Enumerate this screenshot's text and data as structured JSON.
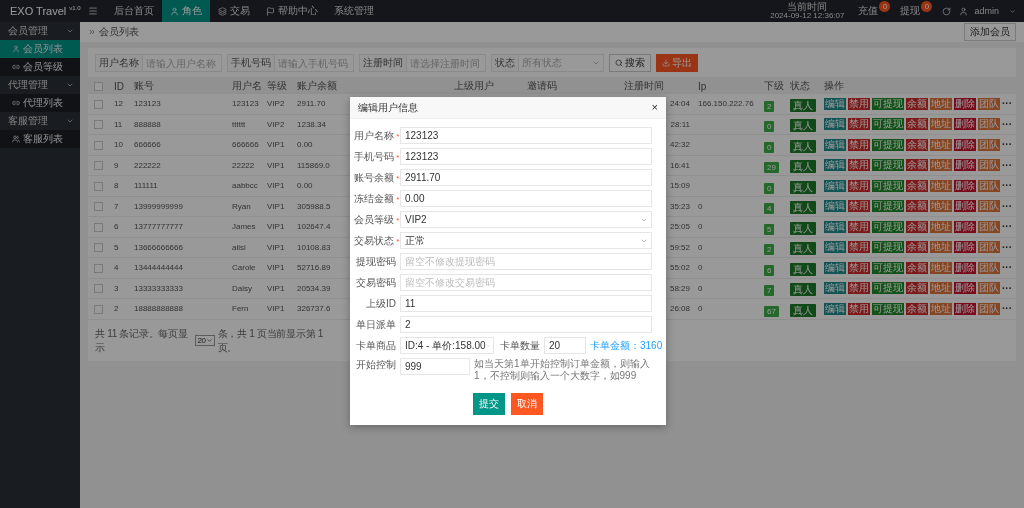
{
  "topbar": {
    "logo": "EXO Travel $^{v1.0}$",
    "nav": [
      {
        "label": "后台首页",
        "selected": false,
        "kind": "plain"
      },
      {
        "label": "角色",
        "selected": true,
        "kind": "user"
      },
      {
        "label": "交易",
        "selected": false,
        "kind": "layers"
      },
      {
        "label": "帮助中心",
        "selected": false,
        "kind": "flag"
      },
      {
        "label": "系统管理",
        "selected": false,
        "kind": "plain"
      }
    ],
    "time_label": "当前时间",
    "time": "2024-09-12 12:36:07",
    "links": [
      {
        "label": "充值",
        "badge": "0"
      },
      {
        "label": "提现",
        "badge": "0"
      }
    ],
    "user": "admin"
  },
  "sidebar": {
    "groups": [
      {
        "label": "会员管理",
        "expanded": true,
        "items": [
          {
            "label": "会员列表",
            "selected": true,
            "kind": "user"
          },
          {
            "label": "会员等级",
            "selected": false,
            "kind": "link"
          }
        ]
      },
      {
        "label": "代理管理",
        "expanded": true,
        "items": [
          {
            "label": "代理列表",
            "selected": false,
            "kind": "link"
          }
        ]
      },
      {
        "label": "客服管理",
        "expanded": true,
        "items": [
          {
            "label": "客服列表",
            "selected": false,
            "kind": "team"
          }
        ]
      }
    ]
  },
  "breadcrumb": "会员列表",
  "add_button": "添加会员",
  "filters": [
    {
      "label": "用户名称",
      "placeholder": "请输入用户名称",
      "kind": "input"
    },
    {
      "label": "手机号码",
      "placeholder": "请输入手机号码",
      "kind": "input"
    },
    {
      "label": "注册时间",
      "placeholder": "请选择注册时间",
      "kind": "input"
    },
    {
      "label": "状态",
      "placeholder": "所有状态",
      "kind": "select"
    }
  ],
  "search_button": "搜索",
  "export_button": "导出",
  "table": {
    "header_checked": false,
    "columns": [
      "ID",
      "账号",
      "用户名",
      "等级",
      "账户余额",
      "上级用户",
      "邀请码",
      "注册时间",
      "Ip",
      "下级",
      "状态",
      "操作"
    ],
    "rows": [
      {
        "checked": false,
        "id": "12",
        "account": "123123",
        "username": "123123",
        "level": "VIP2",
        "balance": "2911.70",
        "time": "24:04",
        "ip": "166.150.222.76",
        "subs": "2",
        "status": "真人",
        "actions": [
          {
            "label": "编辑",
            "color": "#125454"
          },
          {
            "label": "禁用",
            "color": "#7e1a1a"
          },
          {
            "label": "可提现",
            "color": "#145219"
          },
          {
            "label": "余额",
            "color": "#7e1a1a"
          },
          {
            "label": "地址",
            "color": "#864624"
          },
          {
            "label": "删除",
            "color": "#780a1c"
          },
          {
            "label": "团队",
            "color": "#864624"
          }
        ],
        "more": "···"
      },
      {
        "checked": false,
        "id": "11",
        "account": "888888",
        "username": "tttttt",
        "level": "VIP2",
        "balance": "1238.34",
        "time": "28:11",
        "subs": "0",
        "status": "真人",
        "actions": [
          {
            "label": "编辑",
            "color": "#125454"
          },
          {
            "label": "禁用",
            "color": "#7e1a1a"
          },
          {
            "label": "可提现",
            "color": "#145219"
          },
          {
            "label": "余额",
            "color": "#7e1a1a"
          },
          {
            "label": "地址",
            "color": "#864624"
          },
          {
            "label": "删除",
            "color": "#780a1c"
          },
          {
            "label": "团队",
            "color": "#864624"
          }
        ],
        "more": "···"
      },
      {
        "checked": false,
        "id": "10",
        "account": "666666",
        "username": "666666",
        "level": "VIP1",
        "balance": "0.00",
        "time": "42:32",
        "subs": "0",
        "status": "真人",
        "actions": [
          {
            "label": "编辑",
            "color": "#125454"
          },
          {
            "label": "禁用",
            "color": "#7e1a1a"
          },
          {
            "label": "可提现",
            "color": "#145219"
          },
          {
            "label": "余额",
            "color": "#7e1a1a"
          },
          {
            "label": "地址",
            "color": "#864624"
          },
          {
            "label": "删除",
            "color": "#780a1c"
          },
          {
            "label": "团队",
            "color": "#864624"
          }
        ],
        "more": "···"
      },
      {
        "checked": false,
        "id": "9",
        "account": "222222",
        "username": "22222",
        "level": "VIP1",
        "balance": "115869.0",
        "time": "16:41",
        "subs": "29",
        "status": "真人",
        "actions": [
          {
            "label": "编辑",
            "color": "#125454"
          },
          {
            "label": "禁用",
            "color": "#7e1a1a"
          },
          {
            "label": "可提现",
            "color": "#145219"
          },
          {
            "label": "余额",
            "color": "#7e1a1a"
          },
          {
            "label": "地址",
            "color": "#864624"
          },
          {
            "label": "删除",
            "color": "#780a1c"
          },
          {
            "label": "团队",
            "color": "#864624"
          }
        ],
        "more": "···"
      },
      {
        "checked": false,
        "id": "8",
        "account": "111111",
        "username": "aabbcc",
        "level": "VIP1",
        "balance": "0.00",
        "time": "15:09",
        "subs": "0",
        "status": "真人",
        "actions": [
          {
            "label": "编辑",
            "color": "#125454"
          },
          {
            "label": "禁用",
            "color": "#7e1a1a"
          },
          {
            "label": "可提现",
            "color": "#145219"
          },
          {
            "label": "余额",
            "color": "#7e1a1a"
          },
          {
            "label": "地址",
            "color": "#864624"
          },
          {
            "label": "删除",
            "color": "#780a1c"
          },
          {
            "label": "团队",
            "color": "#864624"
          }
        ],
        "more": "···"
      },
      {
        "checked": false,
        "id": "7",
        "account": "13999999999",
        "username": "Ryan",
        "level": "VIP1",
        "balance": "305988.5",
        "time": "35:23",
        "ip": "0",
        "subs": "4",
        "status": "真人",
        "actions": [
          {
            "label": "编辑",
            "color": "#125454"
          },
          {
            "label": "禁用",
            "color": "#7e1a1a"
          },
          {
            "label": "可提现",
            "color": "#145219"
          },
          {
            "label": "余额",
            "color": "#7e1a1a"
          },
          {
            "label": "地址",
            "color": "#864624"
          },
          {
            "label": "删除",
            "color": "#780a1c"
          },
          {
            "label": "团队",
            "color": "#864624"
          }
        ],
        "more": "···"
      },
      {
        "checked": false,
        "id": "6",
        "account": "13777777777",
        "username": "James",
        "level": "VIP1",
        "balance": "102647.4",
        "time": "25:05",
        "ip": "0",
        "subs": "5",
        "status": "真人",
        "actions": [
          {
            "label": "编辑",
            "color": "#125454"
          },
          {
            "label": "禁用",
            "color": "#7e1a1a"
          },
          {
            "label": "可提现",
            "color": "#145219"
          },
          {
            "label": "余额",
            "color": "#7e1a1a"
          },
          {
            "label": "地址",
            "color": "#864624"
          },
          {
            "label": "删除",
            "color": "#780a1c"
          },
          {
            "label": "团队",
            "color": "#864624"
          }
        ],
        "more": "···"
      },
      {
        "checked": false,
        "id": "5",
        "account": "13666666666",
        "username": "alisi",
        "level": "VIP1",
        "balance": "10108.83",
        "time": "59:52",
        "ip": "0",
        "subs": "2",
        "status": "真人",
        "actions": [
          {
            "label": "编辑",
            "color": "#125454"
          },
          {
            "label": "禁用",
            "color": "#7e1a1a"
          },
          {
            "label": "可提现",
            "color": "#145219"
          },
          {
            "label": "余额",
            "color": "#7e1a1a"
          },
          {
            "label": "地址",
            "color": "#864624"
          },
          {
            "label": "删除",
            "color": "#780a1c"
          },
          {
            "label": "团队",
            "color": "#864624"
          }
        ],
        "more": "···"
      },
      {
        "checked": false,
        "id": "4",
        "account": "13444444444",
        "username": "Carole",
        "level": "VIP1",
        "balance": "52716.89",
        "time": "55:02",
        "ip": "0",
        "subs": "6",
        "status": "真人",
        "actions": [
          {
            "label": "编辑",
            "color": "#125454"
          },
          {
            "label": "禁用",
            "color": "#7e1a1a"
          },
          {
            "label": "可提现",
            "color": "#145219"
          },
          {
            "label": "余额",
            "color": "#7e1a1a"
          },
          {
            "label": "地址",
            "color": "#864624"
          },
          {
            "label": "删除",
            "color": "#780a1c"
          },
          {
            "label": "团队",
            "color": "#864624"
          }
        ],
        "more": "···"
      },
      {
        "checked": false,
        "id": "3",
        "account": "13333333333",
        "username": "Daisy",
        "level": "VIP1",
        "balance": "20534.39",
        "time": "58:29",
        "ip": "0",
        "subs": "7",
        "status": "真人",
        "actions": [
          {
            "label": "编辑",
            "color": "#125454"
          },
          {
            "label": "禁用",
            "color": "#7e1a1a"
          },
          {
            "label": "可提现",
            "color": "#145219"
          },
          {
            "label": "余额",
            "color": "#7e1a1a"
          },
          {
            "label": "地址",
            "color": "#864624"
          },
          {
            "label": "删除",
            "color": "#780a1c"
          },
          {
            "label": "团队",
            "color": "#864624"
          }
        ],
        "more": "···"
      },
      {
        "checked": false,
        "id": "2",
        "account": "18888888888",
        "username": "Fern",
        "level": "VIP1",
        "balance": "326737.6",
        "time": "26:08",
        "ip": "0",
        "subs": "67",
        "status": "真人",
        "actions": [
          {
            "label": "编辑",
            "color": "#125454"
          },
          {
            "label": "禁用",
            "color": "#7e1a1a"
          },
          {
            "label": "可提现",
            "color": "#145219"
          },
          {
            "label": "余额",
            "color": "#7e1a1a"
          },
          {
            "label": "地址",
            "color": "#864624"
          },
          {
            "label": "删除",
            "color": "#780a1c"
          },
          {
            "label": "团队",
            "color": "#864624"
          }
        ],
        "more": "···"
      }
    ]
  },
  "pager": {
    "before": "共 11 条记录。每页显示",
    "page_size": "20",
    "after": "条，共 1 页当前显示第 1 页。"
  },
  "modal": {
    "title": "编辑用户信息",
    "close": "×",
    "fields": [
      {
        "kind": "text",
        "label": "用户名称",
        "mark": "*",
        "value": "123123"
      },
      {
        "kind": "text",
        "label": "手机号码",
        "mark": "*",
        "value": "123123"
      },
      {
        "kind": "text",
        "label": "账号余额",
        "mark": "*",
        "value": "2911.70"
      },
      {
        "kind": "text",
        "label": "冻结金额",
        "mark": "*",
        "value": "0.00"
      },
      {
        "kind": "select",
        "label": "会员等级",
        "mark": "*",
        "value": "VIP2"
      },
      {
        "kind": "select",
        "label": "交易状态",
        "mark": "*",
        "value": "正常"
      },
      {
        "kind": "text",
        "label": "提现密码",
        "placeholder": "留空不修改提现密码"
      },
      {
        "kind": "text",
        "label": "交易密码",
        "placeholder": "留空不修改交易密码"
      },
      {
        "kind": "text",
        "label": "上级ID",
        "value": "11"
      },
      {
        "kind": "text",
        "label": "单日派单",
        "value": "2"
      },
      {
        "kind": "card",
        "label": "卡单商品",
        "value": "ID:4 - 单价:158.00",
        "label_2": "卡单数量",
        "value_2": "20",
        "note": "卡单金额：3160"
      },
      {
        "kind": "hint",
        "label": "开始控制",
        "value": "999",
        "note": "如当天第1单开始控制订单金额，则输入1，不控制则输入一个大数字，如999"
      }
    ],
    "submit": "提交",
    "cancel": "取消"
  }
}
